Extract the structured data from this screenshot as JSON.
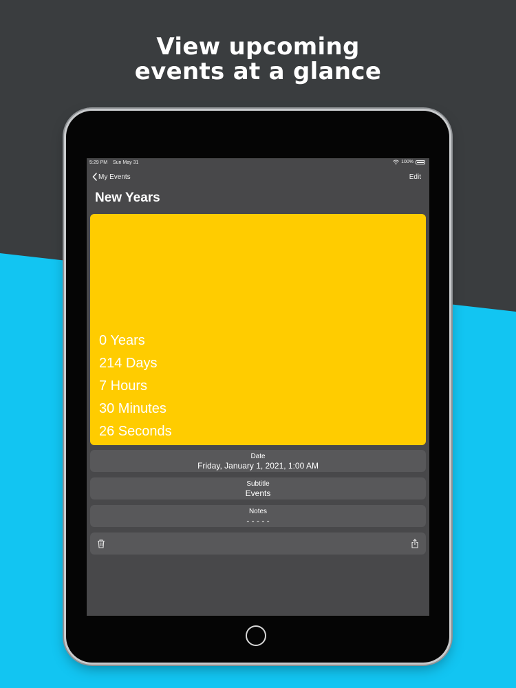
{
  "promo": {
    "headline_line1": "View upcoming",
    "headline_line2": "events at a glance"
  },
  "status_bar": {
    "time": "5:29 PM",
    "date": "Sun May 31",
    "battery": "100%"
  },
  "nav": {
    "back_label": "My Events",
    "edit_label": "Edit"
  },
  "event": {
    "title": "New Years",
    "card_color": "#ffcc00",
    "countdown": [
      "0 Years",
      "214 Days",
      "7 Hours",
      "30 Minutes",
      "26 Seconds"
    ]
  },
  "details": [
    {
      "label": "Date",
      "value": "Friday, January 1, 2021, 1:00 AM"
    },
    {
      "label": "Subtitle",
      "value": "Events"
    },
    {
      "label": "Notes",
      "value": "- - - - -"
    }
  ],
  "toolbar": {
    "left_icon": "trash-icon",
    "right_icon": "share-icon"
  },
  "colors": {
    "background_dark": "#3a3d3f",
    "background_blue": "#12c5f2",
    "screen_bg": "#48484a",
    "row_bg": "#58585a"
  }
}
